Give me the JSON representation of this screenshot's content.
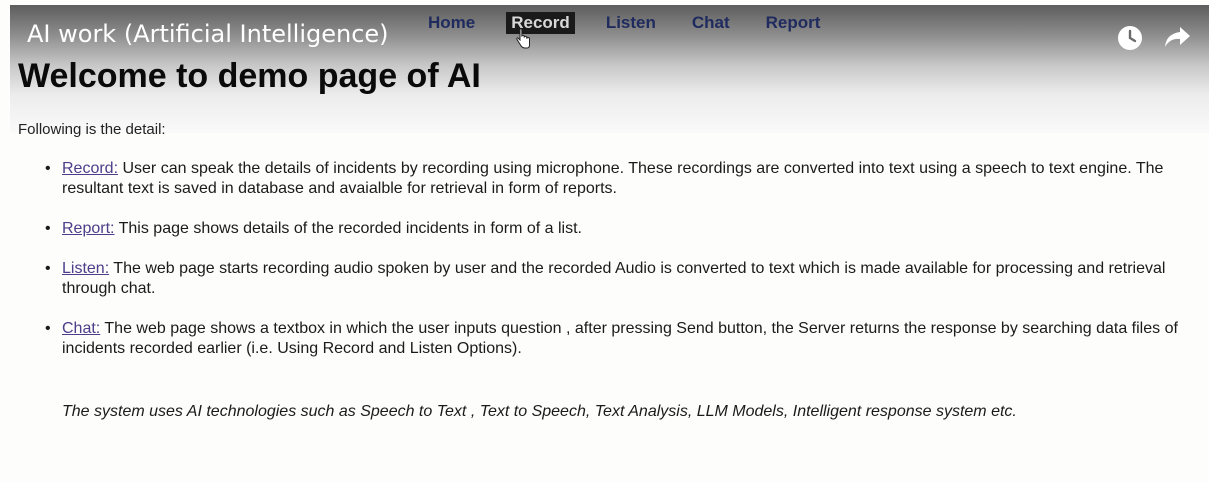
{
  "video": {
    "title": "AI work (Artificial Intelligence)",
    "icons": [
      "clock-icon",
      "share-icon"
    ]
  },
  "nav": {
    "items": [
      {
        "label": "Home",
        "active": false
      },
      {
        "label": "Record",
        "active": true
      },
      {
        "label": "Listen",
        "active": false
      },
      {
        "label": "Chat",
        "active": false
      },
      {
        "label": "Report",
        "active": false
      }
    ]
  },
  "page": {
    "title": "Welcome to demo page of AI",
    "intro": "Following is the detail:",
    "features": [
      {
        "link": "Record:",
        "text": " User can speak the details of incidents by recording using microphone. These recordings are converted into text using a speech to text engine. The resultant text is saved in database and avaialble for retrieval in form of reports."
      },
      {
        "link": "Report:",
        "text": " This page shows details of the recorded incidents in form of a list."
      },
      {
        "link": "Listen:",
        "text": " The web page starts recording audio spoken by user and the recorded Audio is converted to text which is made available for processing and retrieval through chat."
      },
      {
        "link": "Chat:",
        "text": " The web page shows a textbox in which the user inputs question , after pressing Send button, the Server returns the response by searching data files of incidents recorded earlier (i.e. Using Record and Listen Options)."
      }
    ],
    "summary": "The system uses AI technologies such as Speech to Text , Text to Speech, Text Analysis, LLM Models, Intelligent response system etc."
  },
  "colors": {
    "nav_text": "#1f2a5e",
    "nav_active_bg": "#1a1a1a",
    "link": "#4d3d8a"
  }
}
